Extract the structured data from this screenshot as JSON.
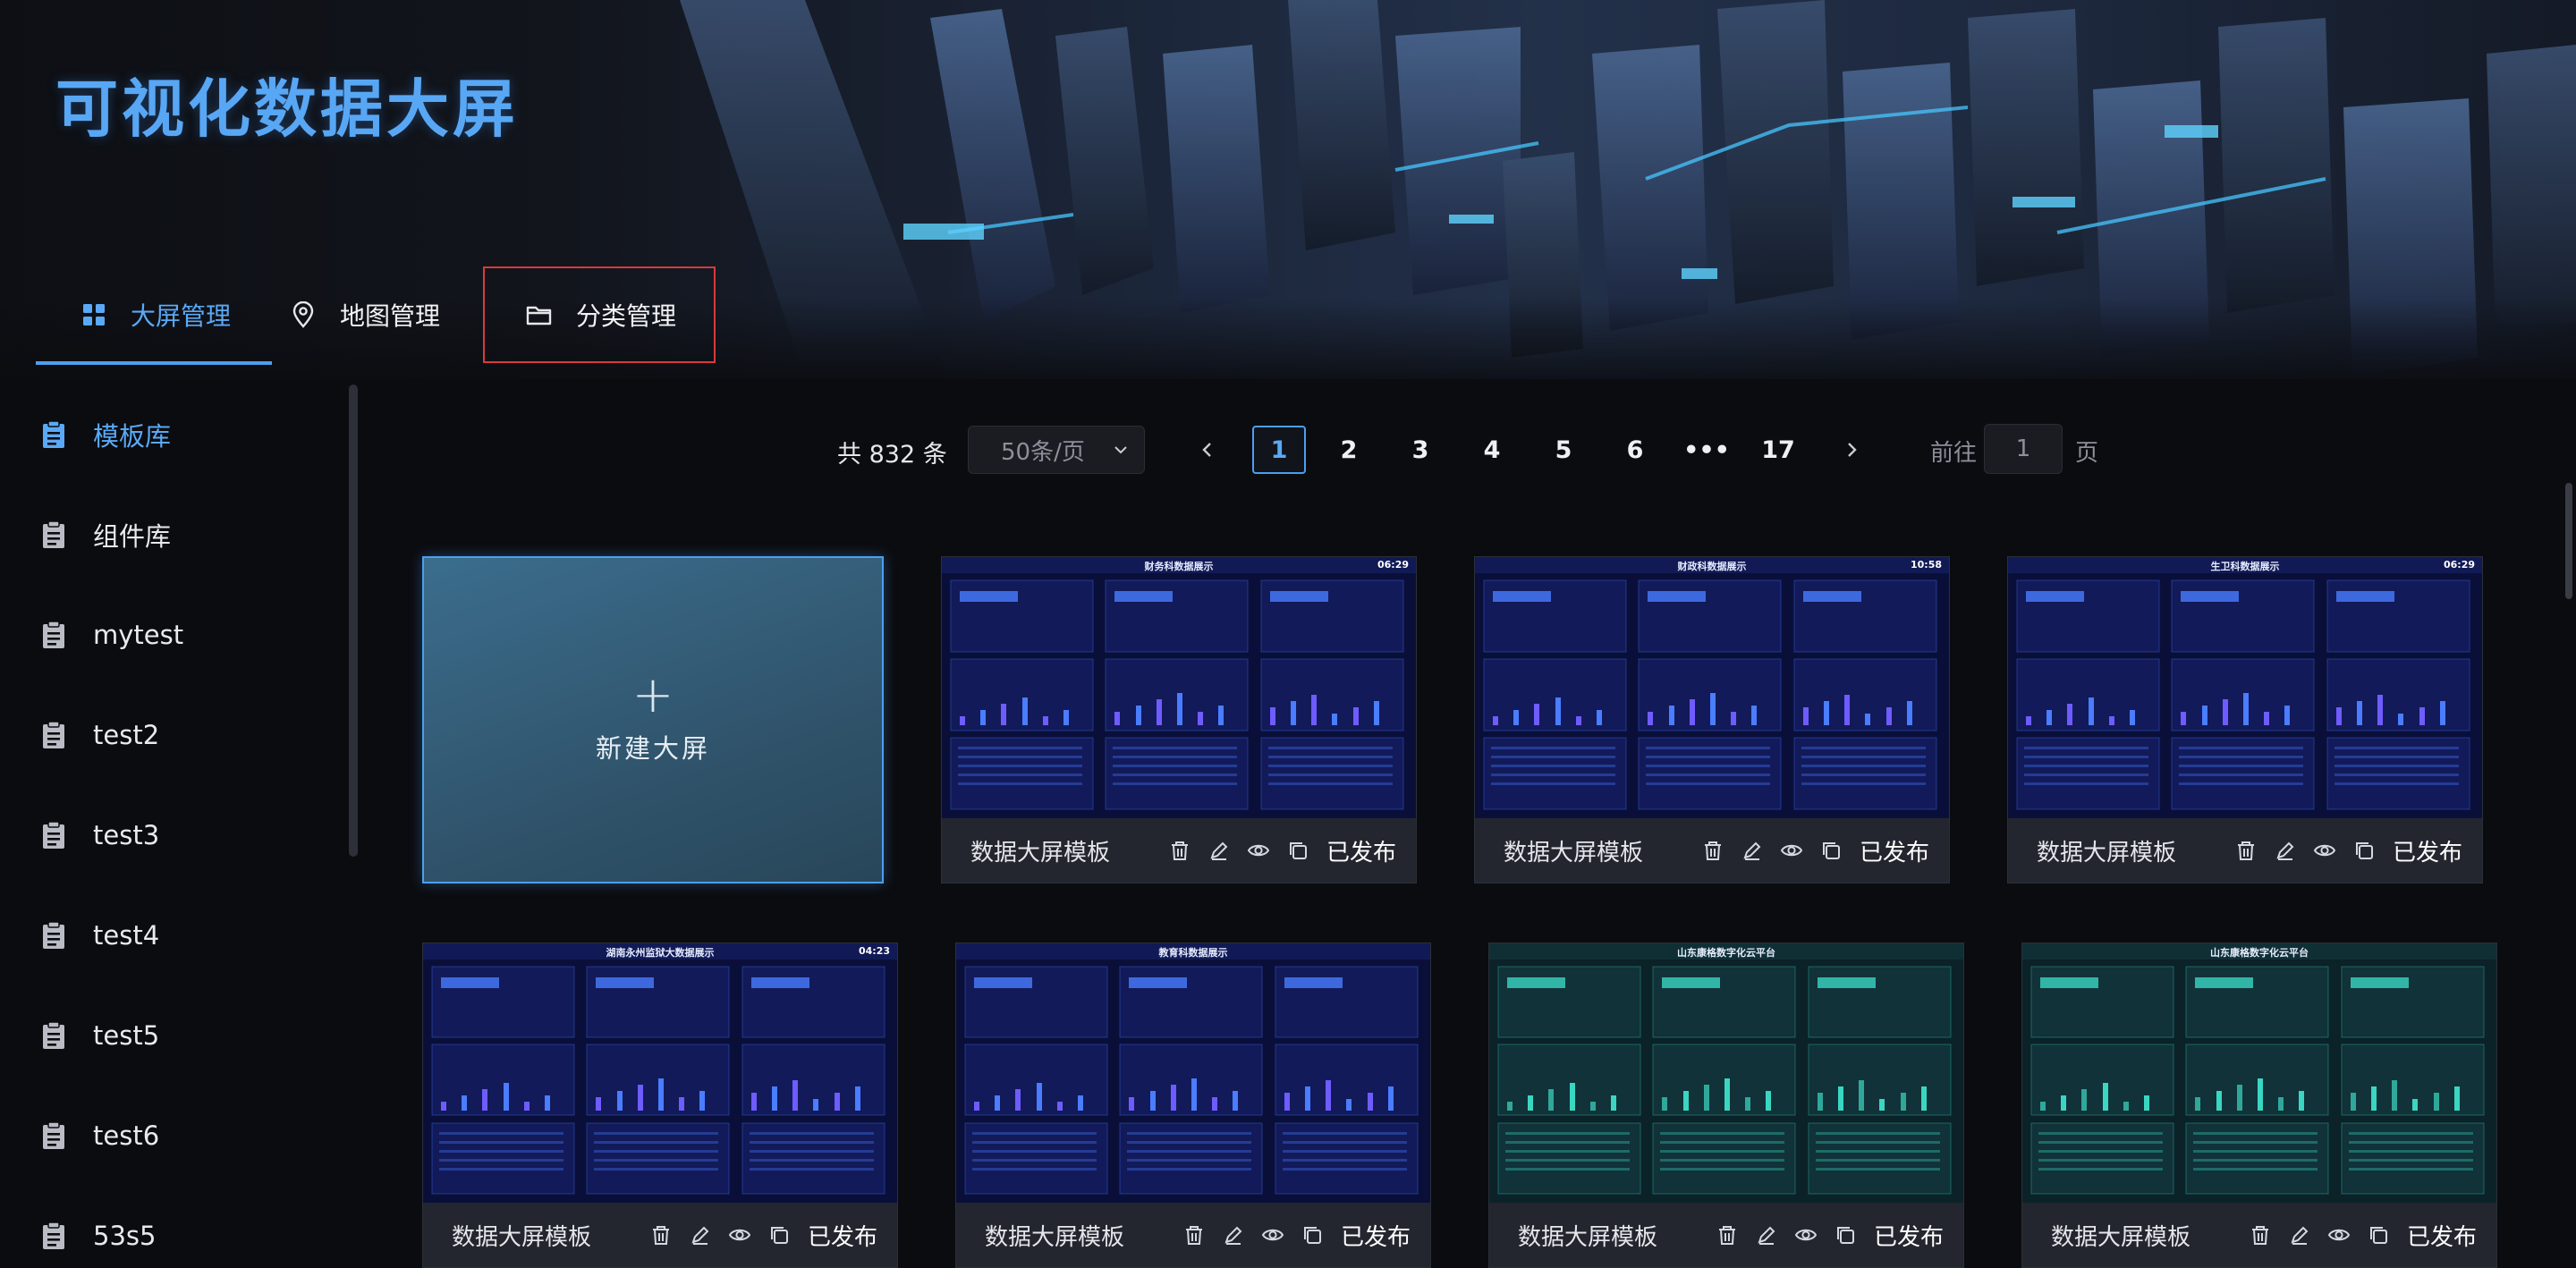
{
  "app": {
    "title": "可视化数据大屏"
  },
  "tabs": [
    {
      "label": "大屏管理",
      "icon": "grid-icon",
      "active": true
    },
    {
      "label": "地图管理",
      "icon": "map-pin-icon",
      "active": false
    },
    {
      "label": "分类管理",
      "icon": "folder-icon",
      "active": false
    }
  ],
  "sidebar": {
    "items": [
      {
        "label": "模板库",
        "active": true
      },
      {
        "label": "组件库",
        "active": false
      },
      {
        "label": "mytest",
        "active": false
      },
      {
        "label": "test2",
        "active": false
      },
      {
        "label": "test3",
        "active": false
      },
      {
        "label": "test4",
        "active": false
      },
      {
        "label": "test5",
        "active": false
      },
      {
        "label": "test6",
        "active": false
      },
      {
        "label": "53s5",
        "active": false
      }
    ]
  },
  "pagination": {
    "total_text": "共 832 条",
    "page_size": "50条/页",
    "pages": [
      "1",
      "2",
      "3",
      "4",
      "5",
      "6",
      "•••",
      "17"
    ],
    "current": "1",
    "goto_label": "前往",
    "goto_value": "1",
    "goto_suffix": "页"
  },
  "new_card": {
    "plus": "+",
    "label": "新建大屏"
  },
  "cards": [
    {
      "name": "数据大屏模板",
      "status": "已发布",
      "thumb_title": "财务科数据展示",
      "time": "06:29",
      "theme": "blue"
    },
    {
      "name": "数据大屏模板",
      "status": "已发布",
      "thumb_title": "财政科数据展示",
      "time": "10:58",
      "theme": "blue"
    },
    {
      "name": "数据大屏模板",
      "status": "已发布",
      "thumb_title": "生卫科数据展示",
      "time": "06:29",
      "theme": "blue"
    },
    {
      "name": "数据大屏模板",
      "status": "已发布",
      "thumb_title": "湖南永州监狱大数据展示",
      "time": "04:23",
      "theme": "blue"
    },
    {
      "name": "数据大屏模板",
      "status": "已发布",
      "thumb_title": "教育科数据展示",
      "time": "",
      "theme": "blue"
    },
    {
      "name": "数据大屏模板",
      "status": "已发布",
      "thumb_title": "山东康格数字化云平台",
      "time": "",
      "theme": "teal"
    },
    {
      "name": "数据大屏模板",
      "status": "已发布",
      "thumb_title": "山东康格数字化云平台",
      "time": "",
      "theme": "teal"
    }
  ],
  "card_actions": [
    "trash-icon",
    "edit-icon",
    "eye-icon",
    "copy-icon"
  ],
  "colors": {
    "accent": "#4c9ff0",
    "title": "#58a7f5",
    "highlight_border": "#d83a3a"
  }
}
